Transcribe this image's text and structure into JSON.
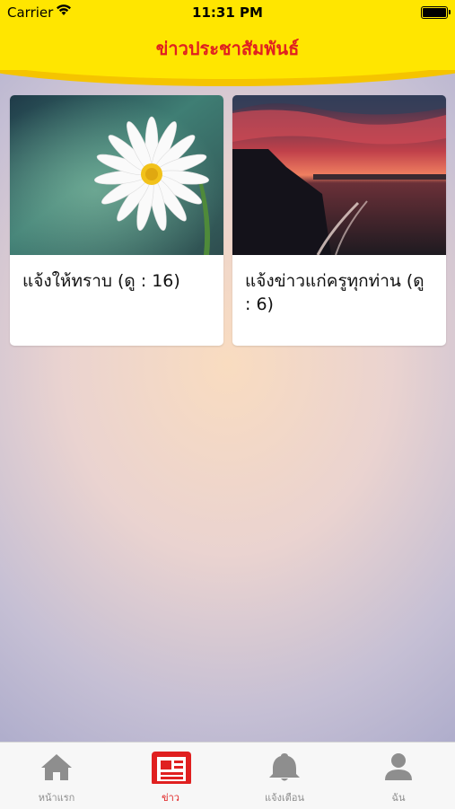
{
  "status_bar": {
    "carrier": "Carrier",
    "time": "11:31 PM"
  },
  "header": {
    "title": "ข่าวประชาสัมพันธ์"
  },
  "cards": [
    {
      "text": "แจ้งให้ทราบ (ดู : 16)",
      "image": "white-daisy-photo"
    },
    {
      "text": "แจ้งข่าวแก่ครูทุกท่าน (ดู : 6)",
      "image": "sunset-lake-photo"
    }
  ],
  "tabs": [
    {
      "label": "หน้าแรก",
      "icon": "home-icon",
      "active": false
    },
    {
      "label": "ข่าว",
      "icon": "news-icon",
      "active": true
    },
    {
      "label": "แจ้งเตือน",
      "icon": "bell-icon",
      "active": false
    },
    {
      "label": "ฉัน",
      "icon": "person-icon",
      "active": false
    }
  ],
  "colors": {
    "header_bg": "#ffe600",
    "accent": "#e02020",
    "tab_inactive": "#8e8e8e"
  }
}
